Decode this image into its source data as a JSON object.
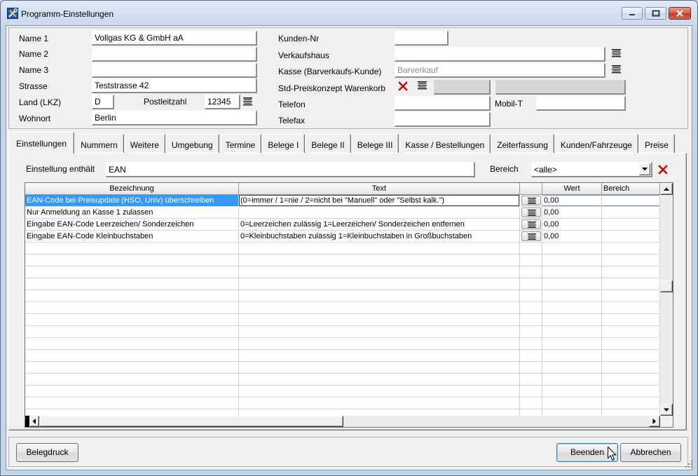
{
  "window": {
    "title": "Programm-Einstellungen",
    "app_icon": "app-tools-icon",
    "minimize_icon": "minimize-icon",
    "maximize_icon": "maximize-icon",
    "close_icon": "close-icon"
  },
  "customer": {
    "name1": {
      "label": "Name 1",
      "value": "Vollgas KG & GmbH aA"
    },
    "name2": {
      "label": "Name 2",
      "value": ""
    },
    "name3": {
      "label": "Name 3",
      "value": ""
    },
    "strasse": {
      "label": "Strasse",
      "value": "Teststrasse 42"
    },
    "land": {
      "label": "Land (LKZ)",
      "value": "D"
    },
    "postleitzahl": {
      "label": "Postleitzahl",
      "value": "12345"
    },
    "wohnort": {
      "label": "Wohnort",
      "value": "Berlin"
    },
    "kunden_nr": {
      "label": "Kunden-Nr",
      "value": ""
    },
    "verkaufshaus": {
      "label": "Verkaufshaus",
      "value": ""
    },
    "kasse": {
      "label": "Kasse (Barverkaufs-Kunde)",
      "value": "Barverkauf"
    },
    "preiskonzept": {
      "label": "Std-Preiskonzept Warenkorb",
      "value1": "",
      "value2": ""
    },
    "telefon": {
      "label": "Telefon",
      "value": ""
    },
    "mobil": {
      "label": "Mobil-T",
      "value": ""
    },
    "telefax": {
      "label": "Telefax",
      "value": ""
    }
  },
  "tabs": [
    "Einstellungen",
    "Nummern",
    "Weitere",
    "Umgebung",
    "Termine",
    "Belege I",
    "Belege II",
    "Belege III",
    "Kasse / Bestellungen",
    "Zeiterfassung",
    "Kunden/Fahrzeuge",
    "Preise"
  ],
  "active_tab_index": 0,
  "filter": {
    "label": "Einstellung enthält",
    "value": "EAN",
    "bereich_label": "Bereich",
    "bereich_value": "<alle>"
  },
  "grid": {
    "columns": [
      "Bezeichnung",
      "Text",
      "",
      "Wert",
      "Bereich"
    ],
    "selected_row": 0,
    "rows": [
      {
        "bezeichnung": "EAN-Code bei Preisupdate (HSO, Univ) überschreiben",
        "text": "(0=immer / 1=nie / 2=nicht bei \"Manuell\" oder \"Selbst kalk.\")",
        "wert": "0,00",
        "bereich": ""
      },
      {
        "bezeichnung": "Nur Anmeldung an Kasse 1 zulassen",
        "text": "",
        "wert": "0,00",
        "bereich": ""
      },
      {
        "bezeichnung": "Eingabe EAN-Code Leerzeichen/ Sonderzeichen",
        "text": "0=Leerzeichen zulässig 1=Leerzeichen/ Sonderzeichen entfernen",
        "wert": "0,00",
        "bereich": ""
      },
      {
        "bezeichnung": "Eingabe EAN-Code Kleinbuchstaben",
        "text": "0=Kleinbuchstaben zulässig 1=Kleinbuchstaben in Großbuchstaben",
        "wert": "0,00",
        "bereich": ""
      }
    ]
  },
  "footer": {
    "belegdruck": "Belegdruck",
    "beenden": "Beenden",
    "abbrechen": "Abbrechen"
  },
  "icons": {
    "list": "list-icon",
    "delete": "delete-x-icon",
    "dropdown": "chevron-down-icon",
    "scroll_up": "arrow-up-icon",
    "scroll_down": "arrow-down-icon",
    "scroll_left": "arrow-left-icon",
    "scroll_right": "arrow-right-icon",
    "cursor": "mouse-cursor-icon",
    "resize": "resize-grip-icon"
  },
  "colors": {
    "selection": "#3399ff",
    "delete": "#cc0000",
    "close_button": "#c94b3d",
    "title_bar": "#c9d8ec",
    "dialog_background": "#f0f0f0"
  }
}
